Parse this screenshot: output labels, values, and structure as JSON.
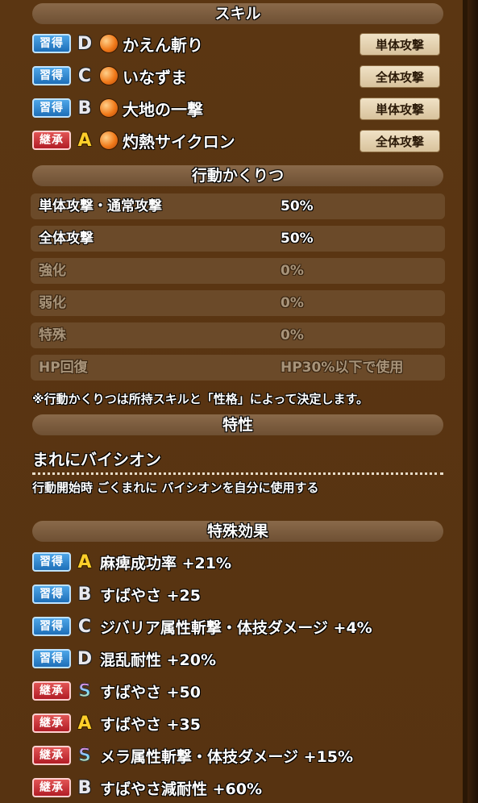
{
  "sections": {
    "skills": "スキル",
    "action_prob": "行動かくりつ",
    "trait": "特性",
    "special": "特殊効果"
  },
  "skills": [
    {
      "badge": "習得",
      "badge_type": "learn",
      "rank": "D",
      "name": "かえん斬り",
      "target": "単体攻撃"
    },
    {
      "badge": "習得",
      "badge_type": "learn",
      "rank": "C",
      "name": "いなずま",
      "target": "全体攻撃"
    },
    {
      "badge": "習得",
      "badge_type": "learn",
      "rank": "B",
      "name": "大地の一撃",
      "target": "単体攻撃"
    },
    {
      "badge": "継承",
      "badge_type": "inherit",
      "rank": "A",
      "name": "灼熱サイクロン",
      "target": "全体攻撃"
    }
  ],
  "action_prob": [
    {
      "label": "単体攻撃・通常攻撃",
      "value": "50%",
      "active": true
    },
    {
      "label": "全体攻撃",
      "value": "50%",
      "active": true
    },
    {
      "label": "強化",
      "value": "0%",
      "active": false
    },
    {
      "label": "弱化",
      "value": "0%",
      "active": false
    },
    {
      "label": "特殊",
      "value": "0%",
      "active": false
    },
    {
      "label": "HP回復",
      "value": "HP30%以下で使用",
      "active": false
    }
  ],
  "note": "※行動かくりつは所持スキルと「性格」によって決定します。",
  "trait": {
    "name": "まれにバイシオン",
    "description": "行動開始時 ごくまれに バイシオンを自分に使用する"
  },
  "special_effects": [
    {
      "badge": "習得",
      "badge_type": "learn",
      "rank": "A",
      "text": "麻痺成功率 +21%"
    },
    {
      "badge": "習得",
      "badge_type": "learn",
      "rank": "B",
      "text": "すばやさ +25"
    },
    {
      "badge": "習得",
      "badge_type": "learn",
      "rank": "C",
      "text": "ジバリア属性斬撃・体技ダメージ +4%"
    },
    {
      "badge": "習得",
      "badge_type": "learn",
      "rank": "D",
      "text": "混乱耐性 +20%"
    },
    {
      "badge": "継承",
      "badge_type": "inherit",
      "rank": "S",
      "text": "すばやさ +50"
    },
    {
      "badge": "継承",
      "badge_type": "inherit",
      "rank": "A",
      "text": "すばやさ +35"
    },
    {
      "badge": "継承",
      "badge_type": "inherit",
      "rank": "S",
      "text": "メラ属性斬撃・体技ダメージ +15%"
    },
    {
      "badge": "継承",
      "badge_type": "inherit",
      "rank": "B",
      "text": "すばやさ減耐性 +60%"
    }
  ],
  "colors": {
    "panel": "#5b3612",
    "learn_badge": "#1e6fb8",
    "inherit_badge": "#b21d26",
    "target_button": "#e6d3b0",
    "rank_A": "#ffcf2a"
  },
  "icons": {
    "skill_orb": "fire-orb-icon"
  }
}
